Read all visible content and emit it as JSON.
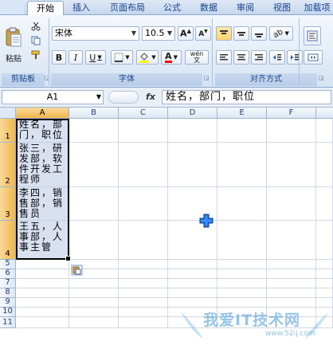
{
  "tabs": [
    {
      "label": "开始",
      "active": true
    },
    {
      "label": "插入"
    },
    {
      "label": "页面布局"
    },
    {
      "label": "公式"
    },
    {
      "label": "数据"
    },
    {
      "label": "审阅"
    },
    {
      "label": "视图"
    },
    {
      "label": "加载项"
    }
  ],
  "ribbon": {
    "clipboard": {
      "paste_label": "粘贴",
      "group_label": "剪贴板"
    },
    "font": {
      "font_name": "宋体",
      "font_size": "10.5",
      "bold": "B",
      "italic": "I",
      "underline": "U",
      "phonetic": "wén",
      "group_label": "字体",
      "fill_color": "#ffff00",
      "font_color": "#ff0000"
    },
    "alignment": {
      "group_label": "对齐方式"
    }
  },
  "formula_bar": {
    "name_box": "A1",
    "fx_label": "fx",
    "content": "姓名，部门，职位"
  },
  "columns": [
    "A",
    "B",
    "C",
    "D",
    "E",
    "F"
  ],
  "rows": [
    "1",
    "2",
    "3",
    "4",
    "5",
    "6",
    "7",
    "8",
    "9",
    "10",
    "11"
  ],
  "cells": {
    "A1": "姓名，部门，职位",
    "A2": "张三，研发部，软件开发工程师",
    "A3": "李四，销售部，销售员",
    "A4": "王五，人事部，人事主管"
  },
  "watermark": {
    "text": "我爱IT技术网",
    "url": "www.52ij.com"
  },
  "colors": {
    "selection_fill": "#d9e1f1",
    "header_highlight": "#f1b64c",
    "ribbon_blue": "#15428b"
  }
}
